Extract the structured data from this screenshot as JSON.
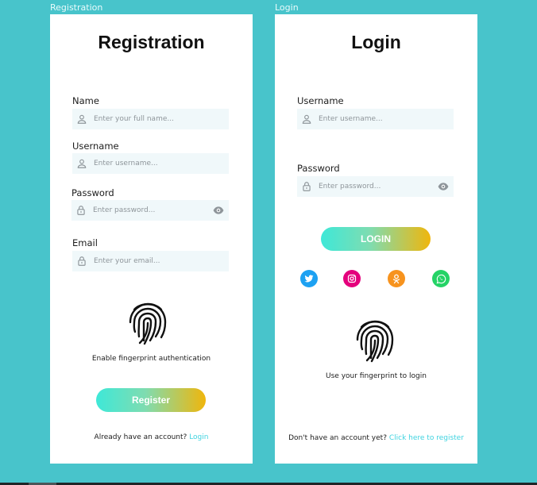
{
  "canvas": {
    "background": "#48c4cb"
  },
  "registration": {
    "frame_label": "Registration",
    "title": "Registration",
    "fields": {
      "name": {
        "label": "Name",
        "placeholder": "Enter your full name...",
        "icon": "user-icon"
      },
      "username": {
        "label": "Username",
        "placeholder": "Enter username...",
        "icon": "user-icon"
      },
      "password": {
        "label": "Password",
        "placeholder": "Enter password...",
        "icon": "lock-icon"
      },
      "email": {
        "label": "Email",
        "placeholder": "Enter your email...",
        "icon": "lock-icon"
      }
    },
    "fingerprint_caption": "Enable fingerprint authentication",
    "register_button": "Register",
    "footer_text": "Already have an account?",
    "footer_link": "Login"
  },
  "login": {
    "frame_label": "Login",
    "title": "Login",
    "fields": {
      "username": {
        "label": "Username",
        "placeholder": "Enter username...",
        "icon": "user-icon"
      },
      "password": {
        "label": "Password",
        "placeholder": "Enter password...",
        "icon": "lock-icon"
      }
    },
    "login_button": "LOGIN",
    "social": [
      {
        "name": "twitter-icon",
        "color": "#1da1f2"
      },
      {
        "name": "instagram-icon",
        "color": "#e4007c"
      },
      {
        "name": "odnoklassniki-icon",
        "color": "#f7931e"
      },
      {
        "name": "whatsapp-icon",
        "color": "#25d366"
      }
    ],
    "fingerprint_caption": "Use your fingerprint to login",
    "footer_text": "Don't have an account yet?",
    "footer_link": "Click here to register"
  },
  "colors": {
    "link": "#3fd3e0",
    "field_bg": "#f0f8fa",
    "button_gradient": [
      "#3ee8d8",
      "#f0b60c"
    ]
  }
}
